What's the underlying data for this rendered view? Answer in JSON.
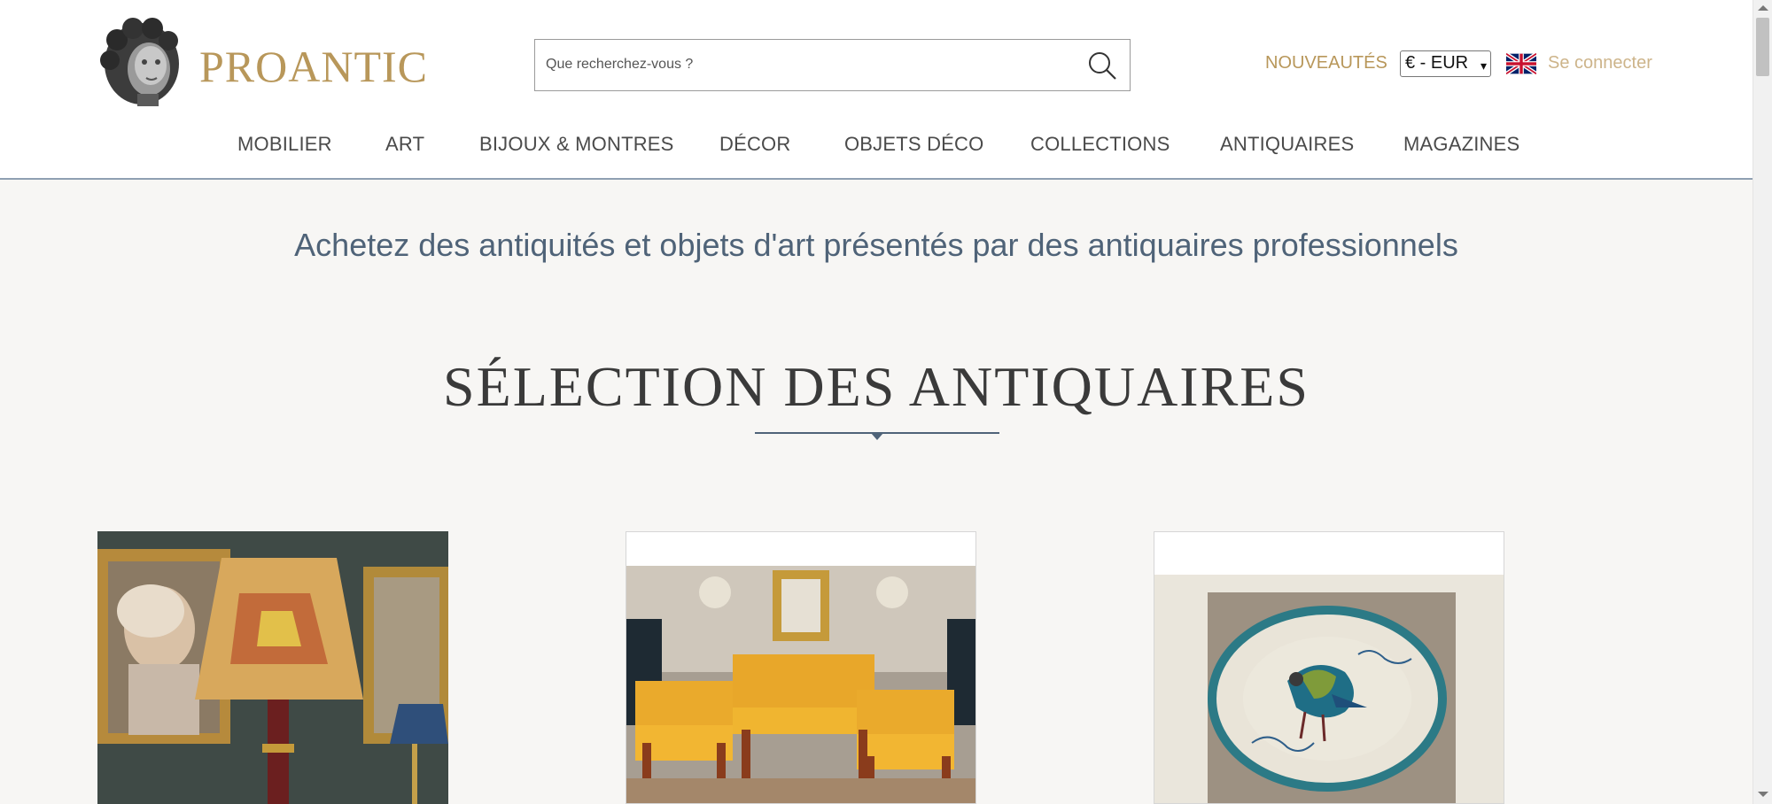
{
  "brand": {
    "name": "PROANTIC"
  },
  "search": {
    "placeholder": "Que recherchez-vous ?"
  },
  "header": {
    "nouveautes_label": "NOUVEAUTÉS",
    "currency": "€ - EUR",
    "signin_label": "Se connecter",
    "language_icon": "uk-flag-icon"
  },
  "nav": {
    "items": [
      {
        "label": "MOBILIER"
      },
      {
        "label": "ART"
      },
      {
        "label": "BIJOUX & MONTRES"
      },
      {
        "label": "DÉCOR"
      },
      {
        "label": "OBJETS DÉCO"
      },
      {
        "label": "COLLECTIONS"
      },
      {
        "label": "ANTIQUAIRES"
      },
      {
        "label": "MAGAZINES"
      }
    ]
  },
  "main": {
    "tagline": "Achetez des antiquités et objets d'art présentés par des antiquaires professionnels",
    "section_title": "SÉLECTION DES ANTIQUAIRES"
  },
  "colors": {
    "gold": "#b8975a",
    "slate": "#4f6378",
    "background": "#f7f6f4"
  }
}
